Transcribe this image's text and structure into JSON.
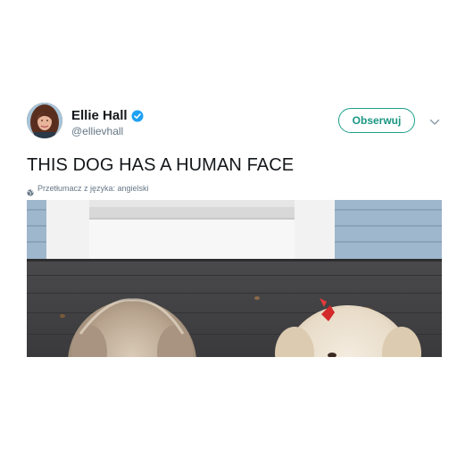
{
  "tweet": {
    "author": {
      "display_name": "Ellie Hall",
      "handle": "@ellievhall",
      "verified": true
    },
    "follow_label": "Obserwuj",
    "menu_icon": "chevron-down-icon",
    "text": "THIS DOG HAS A HUMAN FACE",
    "translate_label": "Przetłumacz z języka: angielski",
    "translate_icon": "globe-icon",
    "colors": {
      "follow_accent": "#1fa18b",
      "verified_badge": "#1da1f2",
      "secondary_text": "#657786"
    }
  }
}
